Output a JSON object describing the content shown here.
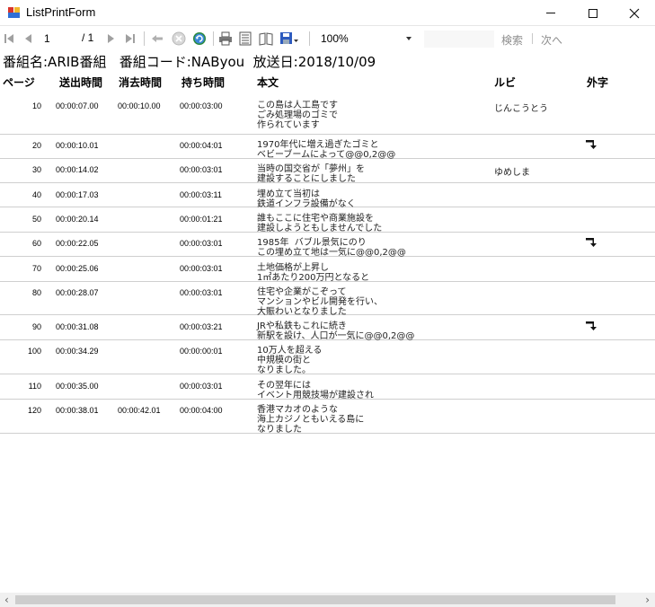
{
  "window": {
    "title": "ListPrintForm",
    "controls": {
      "minimize": "minimize",
      "maximize": "maximize",
      "close": "close"
    }
  },
  "toolbar": {
    "current_page": "1",
    "total_pages": "/ 1",
    "zoom": "100%",
    "find_label": "検索",
    "next_label": "次へ",
    "icons": [
      "first-page-icon",
      "previous-page-icon",
      "next-page-icon",
      "last-page-icon",
      "back-icon",
      "stop-icon",
      "refresh-icon",
      "print-icon",
      "print-layout-icon",
      "page-setup-icon",
      "export-icon"
    ]
  },
  "report": {
    "program_line": "番組名:ARIB番組   番組コード:NAByou  放送日:2018/10/09",
    "headers": {
      "page": "ページ",
      "out_time": "送出時間",
      "del_time": "消去時間",
      "hold_time": "持ち時間",
      "body": "本文",
      "ruby": "ルビ",
      "gaiji": "外字"
    },
    "rows": [
      {
        "page": "10",
        "out": "00:00:07.00",
        "del": "00:00:10.00",
        "hold": "00:00:03:00",
        "body": "この島は人工島です\nごみ処理場のゴミで\n作られています",
        "ruby": "じんこうとう",
        "gaiji": false
      },
      {
        "page": "20",
        "out": "00:00:10.01",
        "del": "",
        "hold": "00:00:04:01",
        "body": "1970年代に増え過ぎたゴミと\nベビーブームによって@@0,2@@",
        "ruby": "",
        "gaiji": true
      },
      {
        "page": "30",
        "out": "00:00:14.02",
        "del": "",
        "hold": "00:00:03:01",
        "body": "当時の国交省が「夢州」を\n建設することにしました",
        "ruby": "ゆめしま",
        "gaiji": false
      },
      {
        "page": "40",
        "out": "00:00:17.03",
        "del": "",
        "hold": "00:00:03:11",
        "body": "埋め立て当初は\n鉄道インフラ設備がなく",
        "ruby": "",
        "gaiji": false
      },
      {
        "page": "50",
        "out": "00:00:20.14",
        "del": "",
        "hold": "00:00:01:21",
        "body": "誰もここに住宅や商業施設を\n建設しようともしませんでした",
        "ruby": "",
        "gaiji": false
      },
      {
        "page": "60",
        "out": "00:00:22.05",
        "del": "",
        "hold": "00:00:03:01",
        "body": "1985年  バブル景気にのり\nこの埋め立て地は一気に@@0,2@@",
        "ruby": "",
        "gaiji": true
      },
      {
        "page": "70",
        "out": "00:00:25.06",
        "del": "",
        "hold": "00:00:03:01",
        "body": "土地価格が上昇し\n1㎡あたり200万円となると",
        "ruby": "",
        "gaiji": false
      },
      {
        "page": "80",
        "out": "00:00:28.07",
        "del": "",
        "hold": "00:00:03:01",
        "body": "住宅や企業がこぞって\nマンションやビル開発を行い、\n大賑わいとなりました",
        "ruby": "",
        "gaiji": false
      },
      {
        "page": "90",
        "out": "00:00:31.08",
        "del": "",
        "hold": "00:00:03:21",
        "body": "JRや私鉄もこれに続き\n新駅を設け、人口が一気に@@0,2@@",
        "ruby": "",
        "gaiji": true
      },
      {
        "page": "100",
        "out": "00:00:34.29",
        "del": "",
        "hold": "00:00:00:01",
        "body": "10万人を超える\n中規模の街と\nなりました。",
        "ruby": "",
        "gaiji": false
      },
      {
        "page": "110",
        "out": "00:00:35.00",
        "del": "",
        "hold": "00:00:03:01",
        "body": "その翌年には\nイベント用競技場が建設され",
        "ruby": "",
        "gaiji": false
      },
      {
        "page": "120",
        "out": "00:00:38.01",
        "del": "00:00:42.01",
        "hold": "00:00:04:00",
        "body": "香港マカオのような\n海上カジノともいえる島に\nなりました",
        "ruby": "",
        "gaiji": false
      }
    ]
  }
}
